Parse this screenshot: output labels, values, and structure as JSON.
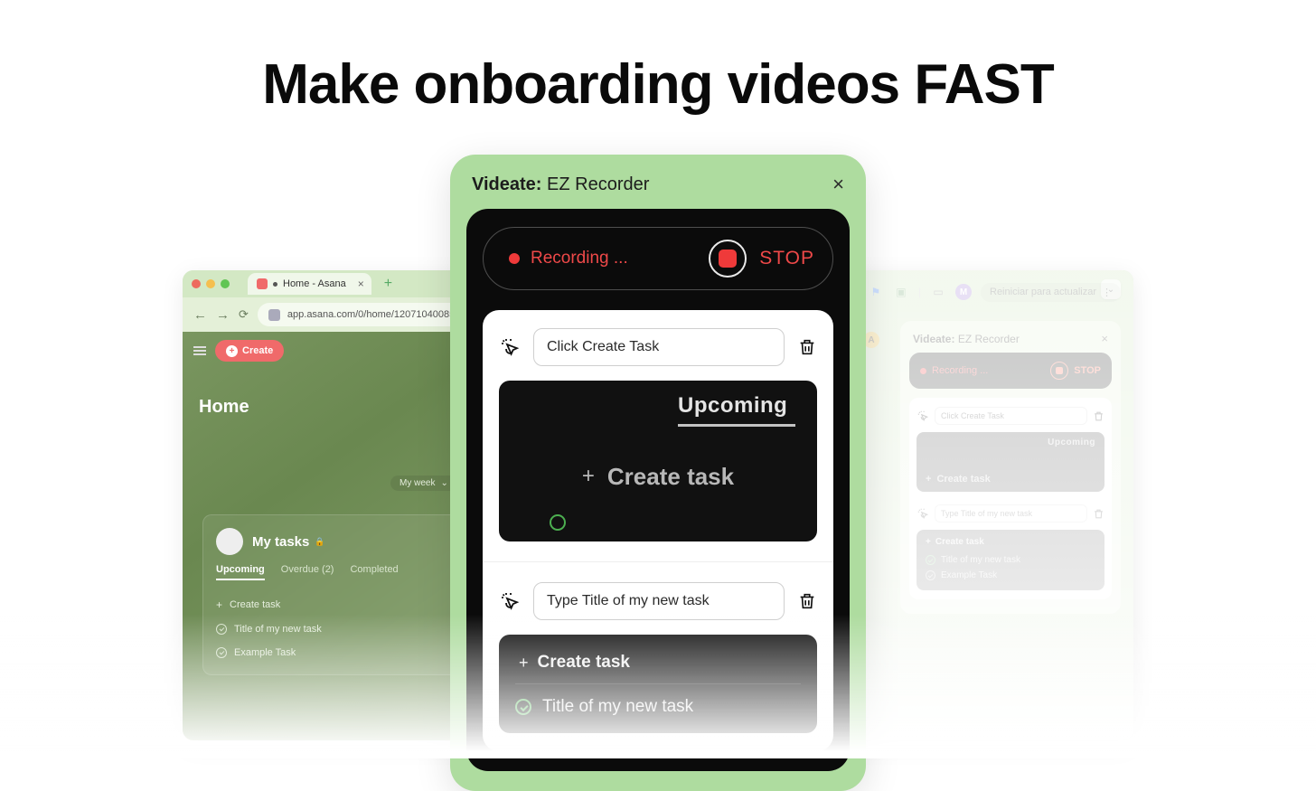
{
  "headline": "Make onboarding videos FAST",
  "left_browser": {
    "tab_title": "Home - Asana",
    "url": "app.asana.com/0/home/12071040085",
    "asana": {
      "create_label": "Create",
      "home_label": "Home",
      "week_label": "My week",
      "card": {
        "title": "My tasks",
        "tab_upcoming": "Upcoming",
        "tab_overdue": "Overdue (2)",
        "tab_completed": "Completed",
        "create_task": "Create task",
        "task1": "Title of my new task",
        "task2": "Example Task"
      }
    }
  },
  "center_recorder": {
    "brand": "Videate:",
    "product": "EZ Recorder",
    "recording_label": "Recording ...",
    "stop_label": "STOP",
    "step1": "Click Create Task",
    "step2": "Type Title of my new task",
    "snap1": {
      "upcoming": "Upcoming",
      "create": "Create task"
    },
    "snap2": {
      "create": "Create task",
      "task": "Title of my new task"
    }
  },
  "right_browser": {
    "reiniciar": "Reiniciar para actualizar",
    "m_badge": "M",
    "yellow_badge": "A",
    "small_recorder": {
      "brand": "Videate:",
      "product": "EZ Recorder",
      "recording_label": "Recording ...",
      "stop_label": "STOP",
      "step1": "Click Create Task",
      "step2": "Type Title of my new task",
      "snap1_upcoming": "Upcoming",
      "snap1_create": "Create task",
      "snap2_create": "Create task",
      "snap2_task1": "Title of my new task",
      "snap2_task2": "Example Task"
    }
  }
}
